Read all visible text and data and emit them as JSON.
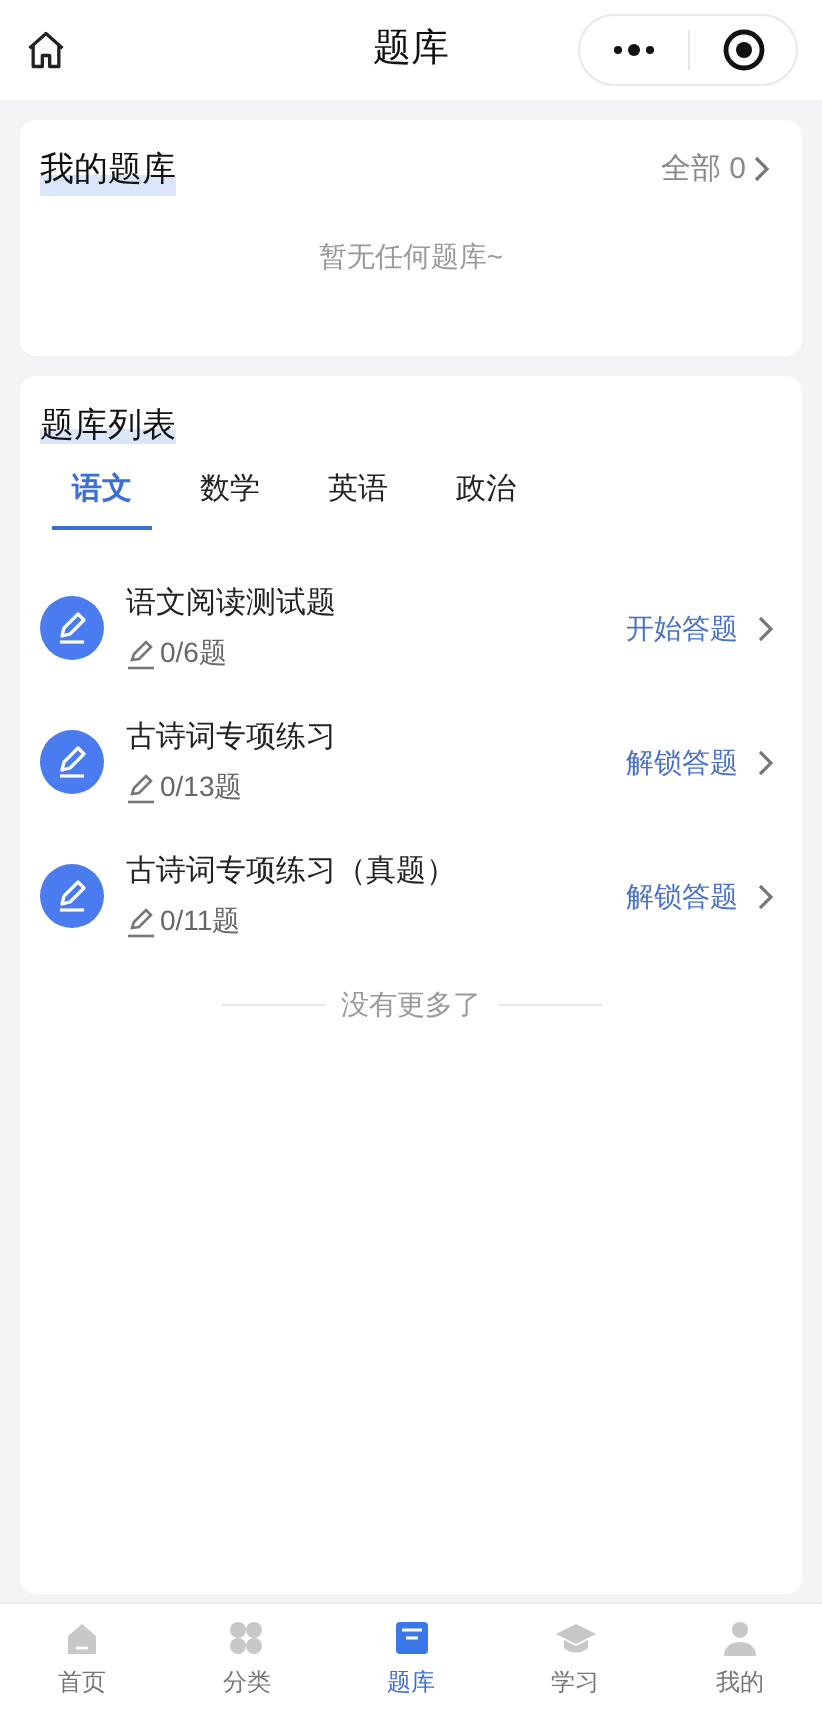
{
  "header": {
    "title": "题库"
  },
  "my_bank": {
    "title": "我的题库",
    "all_link": "全部 0",
    "empty_text": "暂无任何题库~"
  },
  "bank_list": {
    "title": "题库列表",
    "tabs": [
      {
        "label": "语文",
        "selected": true
      },
      {
        "label": "数学",
        "selected": false
      },
      {
        "label": "英语",
        "selected": false
      },
      {
        "label": "政治",
        "selected": false
      }
    ],
    "items": [
      {
        "title": "语文阅读测试题",
        "progress": "0/6题",
        "action": "开始答题"
      },
      {
        "title": "古诗词专项练习",
        "progress": "0/13题",
        "action": "解锁答题"
      },
      {
        "title": "古诗词专项练习（真题）",
        "progress": "0/11题",
        "action": "解锁答题"
      }
    ],
    "end_text": "没有更多了"
  },
  "bottom_nav": [
    {
      "kind": "home",
      "label": "首页",
      "selected": false
    },
    {
      "kind": "category",
      "label": "分类",
      "selected": false
    },
    {
      "kind": "bank",
      "label": "题库",
      "selected": true
    },
    {
      "kind": "study",
      "label": "学习",
      "selected": false
    },
    {
      "kind": "profile",
      "label": "我的",
      "selected": false
    }
  ]
}
